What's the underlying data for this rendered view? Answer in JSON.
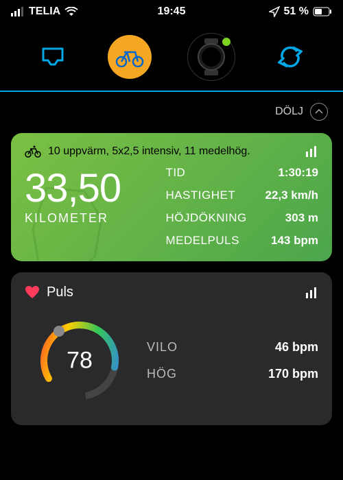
{
  "status": {
    "carrier": "TELIA",
    "time": "19:45",
    "battery": "51 %"
  },
  "hide_label": "DÖLJ",
  "activity": {
    "title": "10 uppvärm, 5x2,5 intensiv, 11 medelhög.",
    "distance_value": "33,50",
    "distance_unit": "KILOMETER",
    "stats": {
      "time_label": "TID",
      "time_val": "1:30:19",
      "speed_label": "HASTIGHET",
      "speed_val": "22,3 km/h",
      "elev_label": "HÖJDÖKNING",
      "elev_val": "303 m",
      "avghr_label": "MEDELPULS",
      "avghr_val": "143 bpm"
    }
  },
  "heart": {
    "title": "Puls",
    "current": "78",
    "rest_label": "VILO",
    "rest_val": "46 bpm",
    "high_label": "HÖG",
    "high_val": "170 bpm"
  }
}
